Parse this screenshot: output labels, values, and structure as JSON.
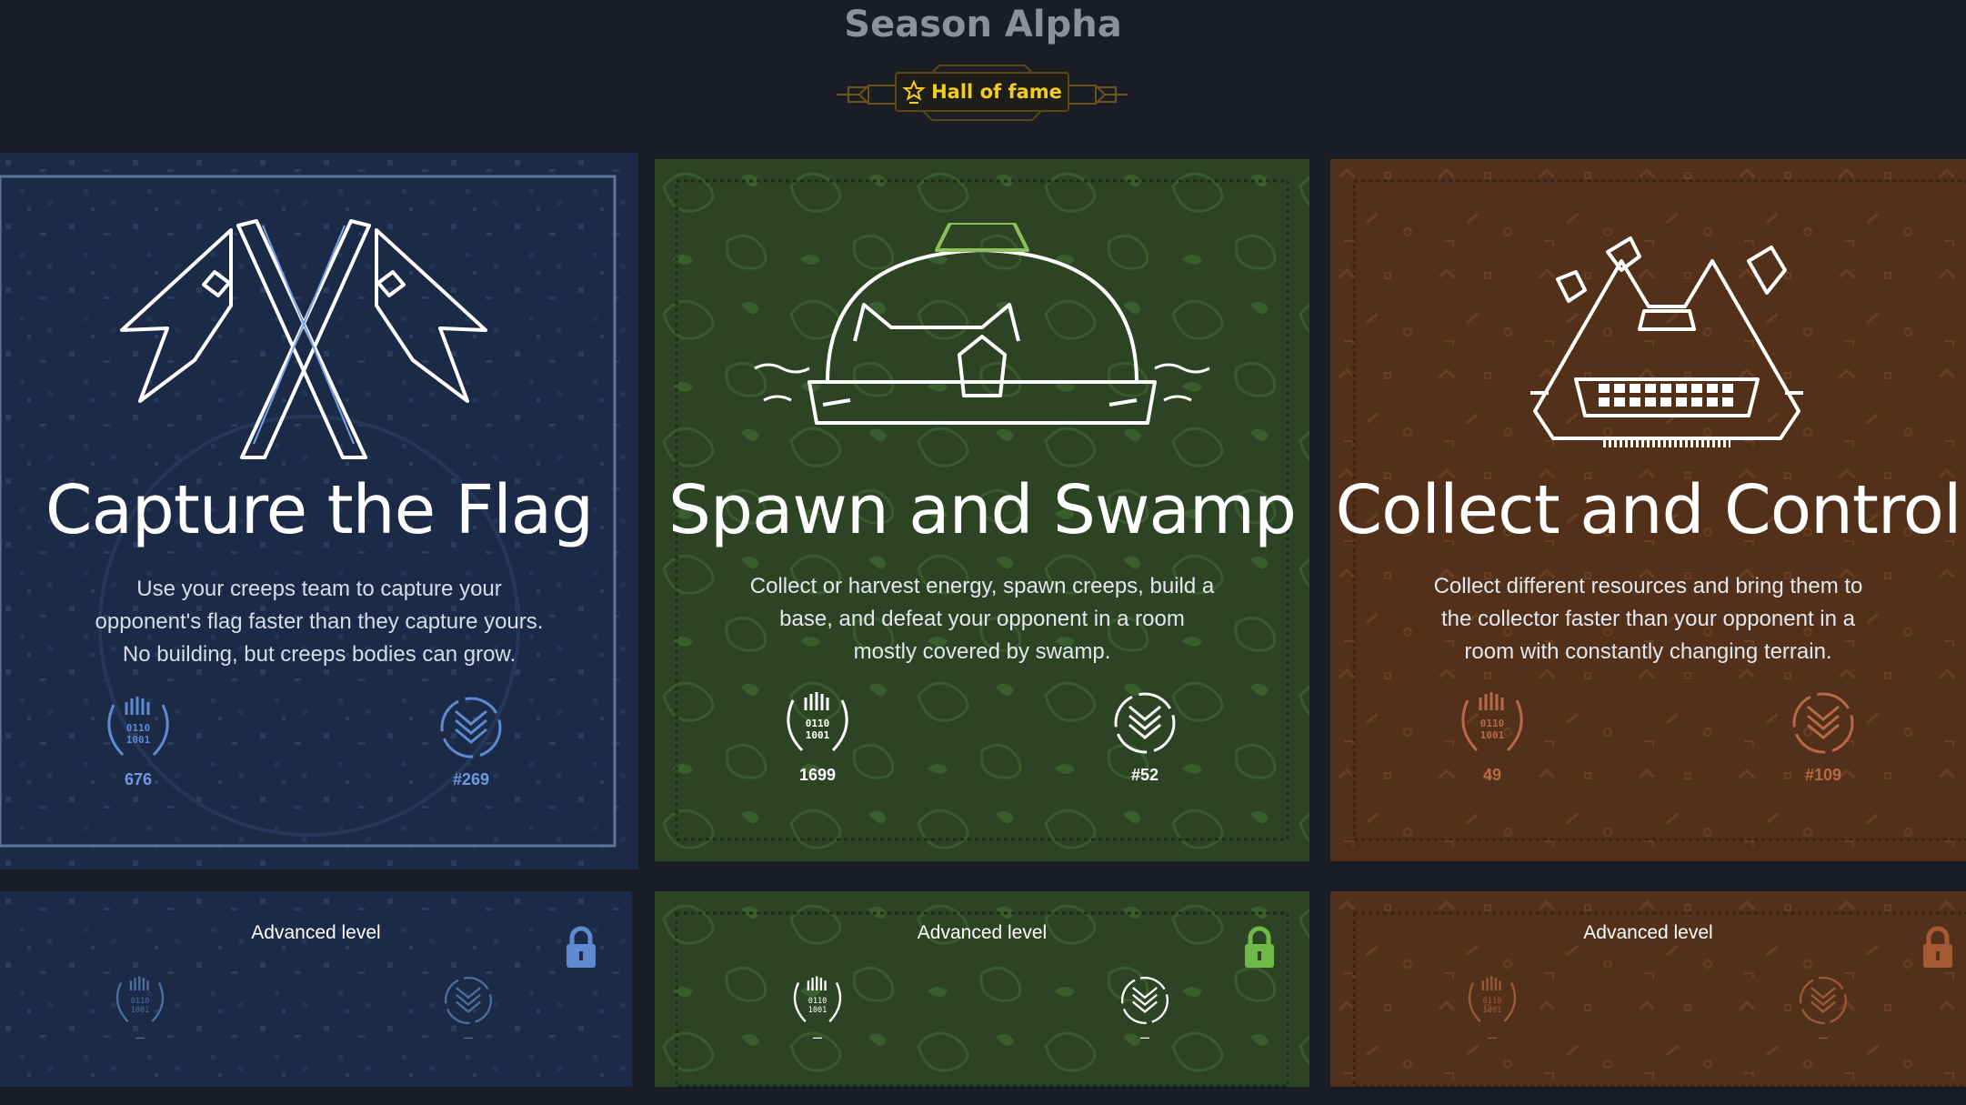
{
  "header": {
    "title": "Season Alpha",
    "hall_of_fame_label": "Hall of fame"
  },
  "colors": {
    "page_bg": "#1a1d26",
    "ctf": "#1b2b47",
    "sas": "#2c4423",
    "cac": "#52301a",
    "gold": "#f2cc1e"
  },
  "cards": [
    {
      "title": "Capture the Flag",
      "description": [
        "Use your creeps team to capture your",
        "opponent's flag faster than they capture yours.",
        "No building, but creeps bodies can grow."
      ],
      "score": "676",
      "rank": "#269",
      "icon": "crossed-flags-icon"
    },
    {
      "title": "Spawn and Swamp",
      "description": [
        "Collect or harvest energy, spawn creeps, build a",
        "base, and defeat your opponent in a room",
        "mostly covered by swamp."
      ],
      "score": "1699",
      "rank": "#52",
      "icon": "spawn-dome-icon"
    },
    {
      "title": "Collect and Control",
      "description": [
        "Collect different resources and bring them to",
        "the collector faster than your opponent in a",
        "room with constantly changing terrain."
      ],
      "score": "49",
      "rank": "#109",
      "icon": "collector-icon"
    }
  ],
  "advanced": [
    {
      "label": "Advanced level",
      "score": "–",
      "rank": "–"
    },
    {
      "label": "Advanced level",
      "score": "–",
      "rank": "–"
    },
    {
      "label": "Advanced level",
      "score": "–",
      "rank": "–"
    }
  ]
}
